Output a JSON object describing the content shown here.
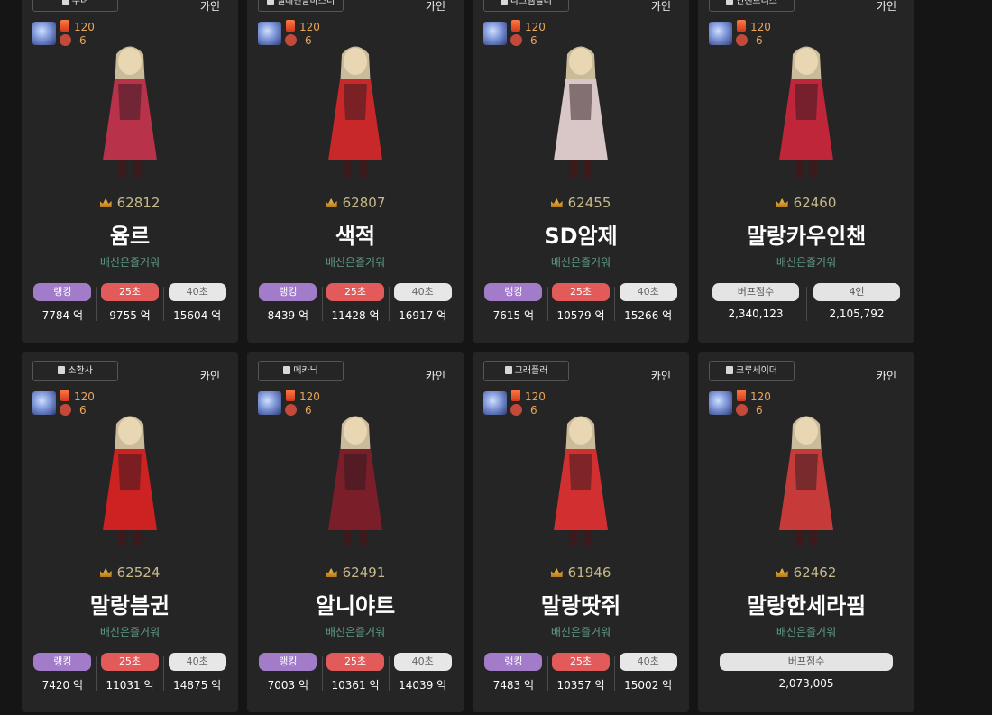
{
  "server_label": "카인",
  "level": "120",
  "adv_level": "6",
  "cards": [
    {
      "job": "무녀",
      "fame": "62812",
      "name": "윰르",
      "guild": "배신은즐거워",
      "theme": "#b8334a",
      "stats": [
        {
          "label": "랭킹",
          "style": "rank",
          "value": "7784 억"
        },
        {
          "label": "25초",
          "style": "s25",
          "value": "9755 억"
        },
        {
          "label": "40초",
          "style": "s40",
          "value": "15604 억"
        }
      ]
    },
    {
      "job": "엘레멘탈마스터",
      "fame": "62807",
      "name": "색적",
      "guild": "배신은즐거워",
      "theme": "#c8282a",
      "stats": [
        {
          "label": "랭킹",
          "style": "rank",
          "value": "8439 억"
        },
        {
          "label": "25초",
          "style": "s25",
          "value": "11428 억"
        },
        {
          "label": "40초",
          "style": "s40",
          "value": "16917 억"
        }
      ]
    },
    {
      "job": "다크템플러",
      "fame": "62455",
      "name": "SD암제",
      "guild": "배신은즐거워",
      "theme": "#d9c6c6",
      "stats": [
        {
          "label": "랭킹",
          "style": "rank",
          "value": "7615 억"
        },
        {
          "label": "25초",
          "style": "s25",
          "value": "10579 억"
        },
        {
          "label": "40초",
          "style": "s40",
          "value": "15266 억"
        }
      ]
    },
    {
      "job": "인챈트리스",
      "fame": "62460",
      "name": "말랑카우인챈",
      "guild": "배신은즐거워",
      "theme": "#c0263a",
      "stats": [
        {
          "label": "버프점수",
          "style": "buff",
          "value": "2,340,123"
        },
        {
          "label": "4인",
          "style": "buff",
          "value": "2,105,792"
        }
      ]
    },
    {
      "job": "소환사",
      "fame": "62524",
      "name": "말랑븜귄",
      "guild": "배신은즐거워",
      "theme": "#cc2222",
      "stats": [
        {
          "label": "랭킹",
          "style": "rank",
          "value": "7420 억"
        },
        {
          "label": "25초",
          "style": "s25",
          "value": "11031 억"
        },
        {
          "label": "40초",
          "style": "s40",
          "value": "14875 억"
        }
      ]
    },
    {
      "job": "메카닉",
      "fame": "62491",
      "name": "알니야트",
      "guild": "배신은즐거워",
      "theme": "#7a1f2a",
      "stats": [
        {
          "label": "랭킹",
          "style": "rank",
          "value": "7003 억"
        },
        {
          "label": "25초",
          "style": "s25",
          "value": "10361 억"
        },
        {
          "label": "40초",
          "style": "s40",
          "value": "14039 억"
        }
      ]
    },
    {
      "job": "그래플러",
      "fame": "61946",
      "name": "말랑땃쥐",
      "guild": "배신은즐거워",
      "theme": "#d23030",
      "stats": [
        {
          "label": "랭킹",
          "style": "rank",
          "value": "7483 억"
        },
        {
          "label": "25초",
          "style": "s25",
          "value": "10357 억"
        },
        {
          "label": "40초",
          "style": "s40",
          "value": "15002 억"
        }
      ]
    },
    {
      "job": "크루세이더",
      "fame": "62462",
      "name": "말랑한세라핌",
      "guild": "배신은즐거워",
      "theme": "#c73a3a",
      "stats": [
        {
          "label": "버프점수",
          "style": "buff wide",
          "value": "2,073,005"
        }
      ]
    }
  ]
}
